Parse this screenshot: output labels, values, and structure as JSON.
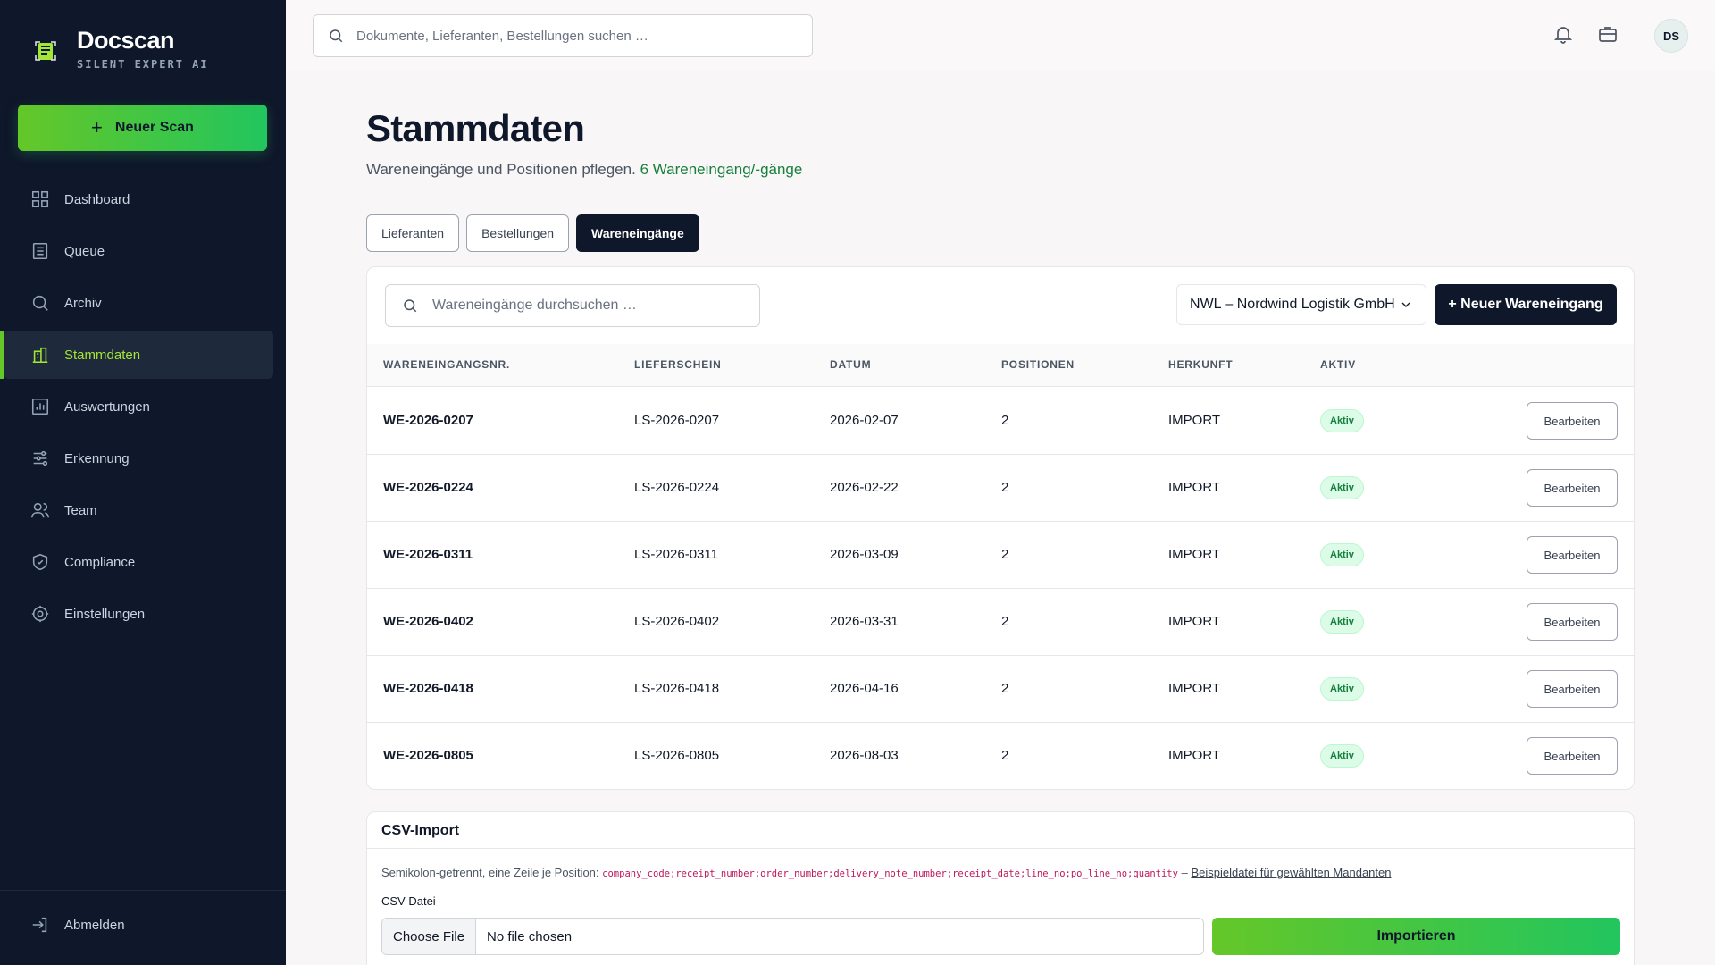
{
  "brand": {
    "name": "Docscan",
    "subtitle": "SILENT EXPERT AI"
  },
  "sidebar": {
    "new_scan_label": "Neuer Scan",
    "items": [
      {
        "label": "Dashboard",
        "icon": "grid-icon"
      },
      {
        "label": "Queue",
        "icon": "list-icon"
      },
      {
        "label": "Archiv",
        "icon": "search-icon"
      },
      {
        "label": "Stammdaten",
        "icon": "building-icon",
        "active": true
      },
      {
        "label": "Auswertungen",
        "icon": "chart-icon"
      },
      {
        "label": "Erkennung",
        "icon": "sliders-icon"
      },
      {
        "label": "Team",
        "icon": "users-icon"
      },
      {
        "label": "Compliance",
        "icon": "shield-icon"
      },
      {
        "label": "Einstellungen",
        "icon": "gear-icon"
      }
    ],
    "logout_label": "Abmelden"
  },
  "header": {
    "search_placeholder": "Dokumente, Lieferanten, Bestellungen suchen …",
    "avatar_initials": "DS"
  },
  "page": {
    "title": "Stammdaten",
    "subtitle": "Wareneingänge und Positionen pflegen.",
    "count_text": "6 Wareneingang/-gänge"
  },
  "tabs": [
    {
      "label": "Lieferanten"
    },
    {
      "label": "Bestellungen"
    },
    {
      "label": "Wareneingänge",
      "active": true
    }
  ],
  "table": {
    "search_placeholder": "Wareneingänge durchsuchen …",
    "company_select": "NWL – Nordwind Logistik GmbH",
    "new_button": "+ Neuer Wareneingang",
    "columns": [
      "WARENEINGANGSNR.",
      "LIEFERSCHEIN",
      "DATUM",
      "POSITIONEN",
      "HERKUNFT",
      "AKTIV"
    ],
    "edit_label": "Bearbeiten",
    "rows": [
      {
        "nr": "WE-2026-0207",
        "lieferschein": "LS-2026-0207",
        "datum": "2026-02-07",
        "positionen": "2",
        "herkunft": "IMPORT",
        "aktiv": "Aktiv"
      },
      {
        "nr": "WE-2026-0224",
        "lieferschein": "LS-2026-0224",
        "datum": "2026-02-22",
        "positionen": "2",
        "herkunft": "IMPORT",
        "aktiv": "Aktiv"
      },
      {
        "nr": "WE-2026-0311",
        "lieferschein": "LS-2026-0311",
        "datum": "2026-03-09",
        "positionen": "2",
        "herkunft": "IMPORT",
        "aktiv": "Aktiv"
      },
      {
        "nr": "WE-2026-0402",
        "lieferschein": "LS-2026-0402",
        "datum": "2026-03-31",
        "positionen": "2",
        "herkunft": "IMPORT",
        "aktiv": "Aktiv"
      },
      {
        "nr": "WE-2026-0418",
        "lieferschein": "LS-2026-0418",
        "datum": "2026-04-16",
        "positionen": "2",
        "herkunft": "IMPORT",
        "aktiv": "Aktiv"
      },
      {
        "nr": "WE-2026-0805",
        "lieferschein": "LS-2026-0805",
        "datum": "2026-08-03",
        "positionen": "2",
        "herkunft": "IMPORT",
        "aktiv": "Aktiv"
      }
    ]
  },
  "csv": {
    "title": "CSV-Import",
    "hint_prefix": "Semikolon-getrennt, eine Zeile je Position:",
    "hint_columns": "company_code;receipt_number;order_number;delivery_note_number;receipt_date;line_no;po_line_no;quantity",
    "hint_sep": "–",
    "example_link": "Beispieldatei für gewählten Mandanten",
    "file_label": "CSV-Datei",
    "choose_file": "Choose File",
    "no_file": "No file chosen",
    "import_button": "Importieren"
  },
  "colors": {
    "sidebar_bg": "#0f172a",
    "accent_green": "#65c728",
    "active_text": "#a3e635",
    "primary_dark": "#0f172a",
    "badge_bg": "#dcfce7"
  }
}
